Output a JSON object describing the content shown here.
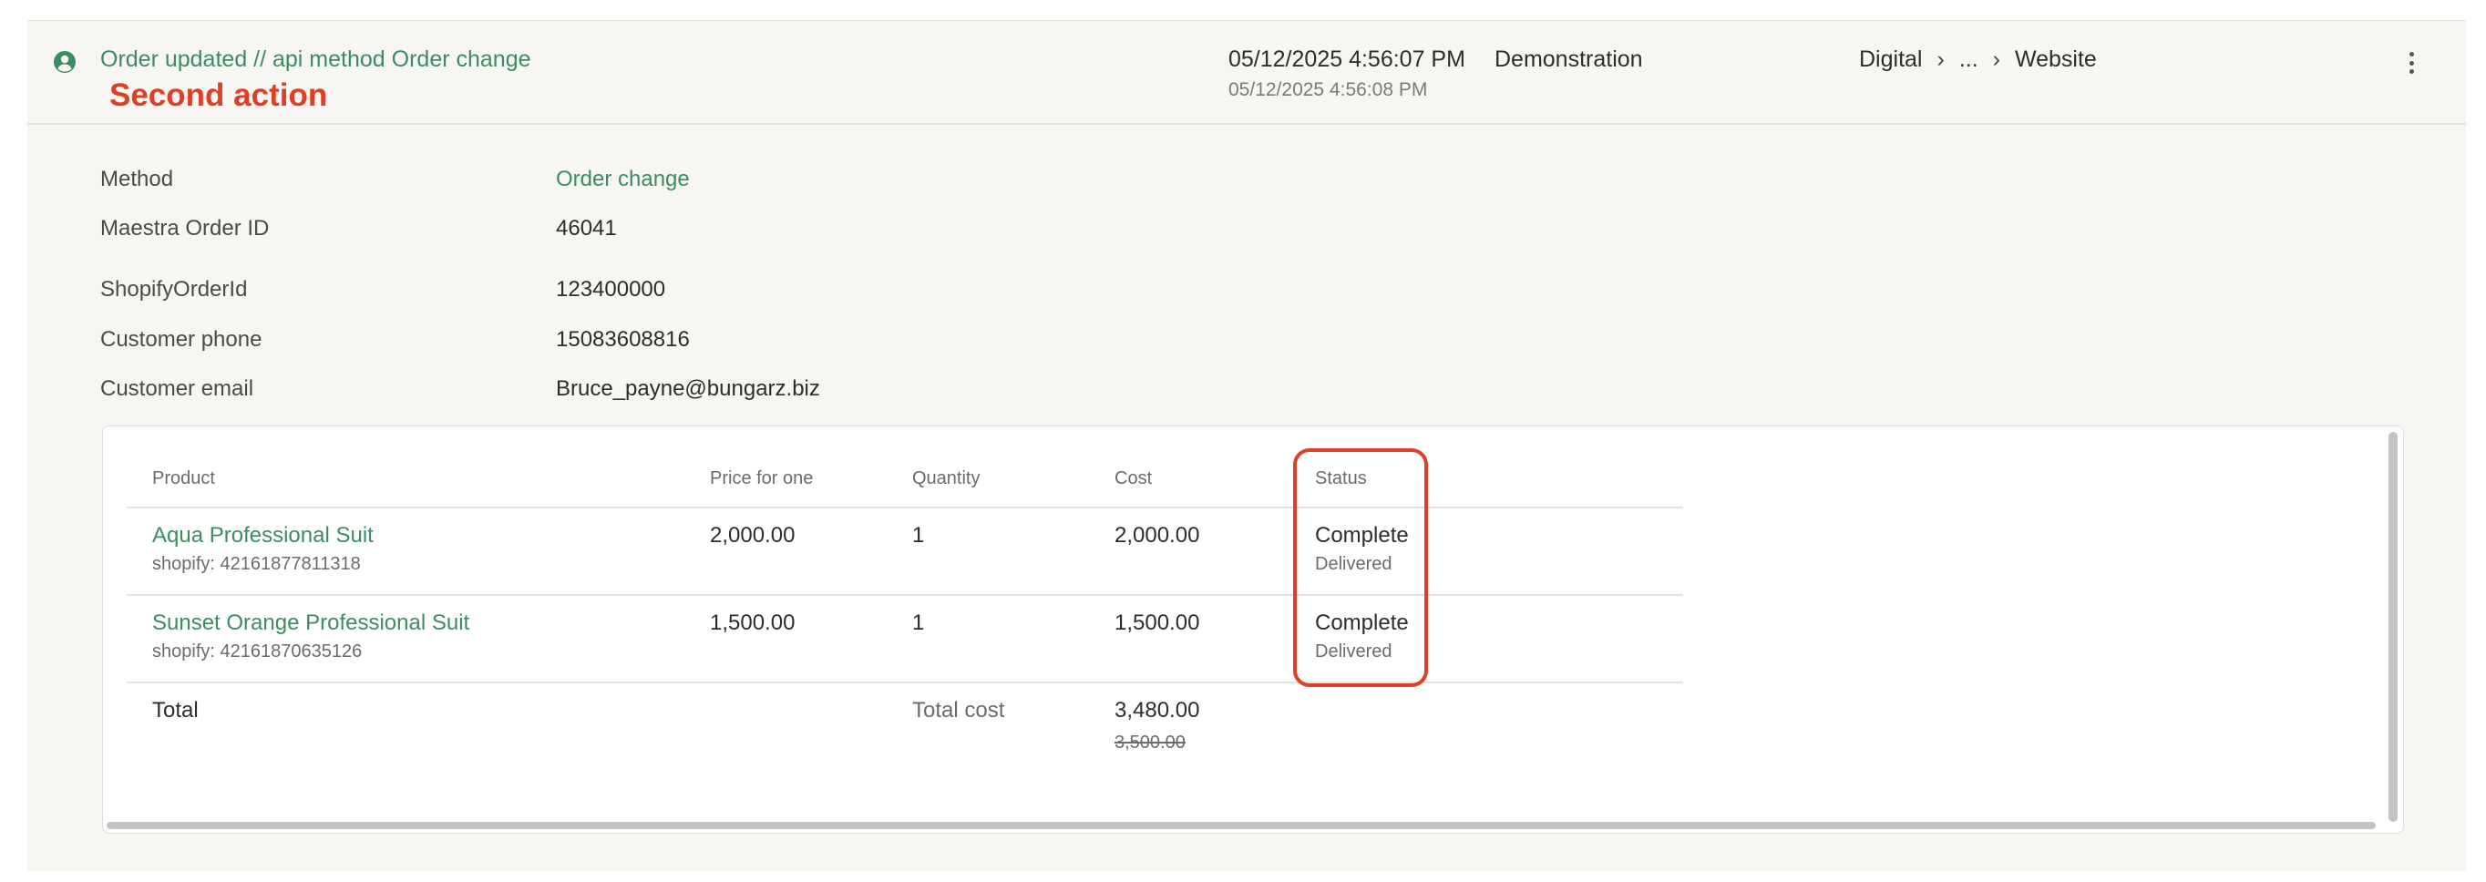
{
  "header": {
    "event_title": "Order updated // api method Order change",
    "annotation": "Second action",
    "date_main": "05/12/2025 4:56:07 PM",
    "date_sub": "05/12/2025 4:56:08 PM",
    "environment": "Demonstration",
    "breadcrumb": [
      "Digital",
      "...",
      "Website"
    ],
    "breadcrumb_sep": "›"
  },
  "fields": {
    "method": {
      "label": "Method",
      "value": "Order change"
    },
    "maestra_order_id": {
      "label": "Maestra Order ID",
      "value": "46041"
    },
    "shopify_order_id": {
      "label": "ShopifyOrderId",
      "value": "123400000"
    },
    "customer_phone": {
      "label": "Customer phone",
      "value": "15083608816"
    },
    "customer_email": {
      "label": "Customer email",
      "value": "Bruce_payne@bungarz.biz"
    }
  },
  "table": {
    "columns": [
      "Product",
      "Price for one",
      "Quantity",
      "Cost",
      "Status"
    ],
    "rows": [
      {
        "product": "Aqua Professional Suit",
        "sku": "shopify: 42161877811318",
        "price": "2,000.00",
        "quantity": "1",
        "cost": "2,000.00",
        "status": "Complete",
        "substatus": "Delivered"
      },
      {
        "product": "Sunset Orange Professional Suit",
        "sku": "shopify: 42161870635126",
        "price": "1,500.00",
        "quantity": "1",
        "cost": "1,500.00",
        "status": "Complete",
        "substatus": "Delivered"
      }
    ],
    "total_label": "Total",
    "total_cost_label": "Total cost",
    "total_cost": "3,480.00",
    "total_cost_original": "3,500.00"
  },
  "colors": {
    "accent_green": "#3c8c63",
    "annotation_red": "#e03f26",
    "panel_bg": "#f7f6f3"
  },
  "icons": {
    "user": "user-circle-icon",
    "menu": "kebab-menu-icon"
  }
}
